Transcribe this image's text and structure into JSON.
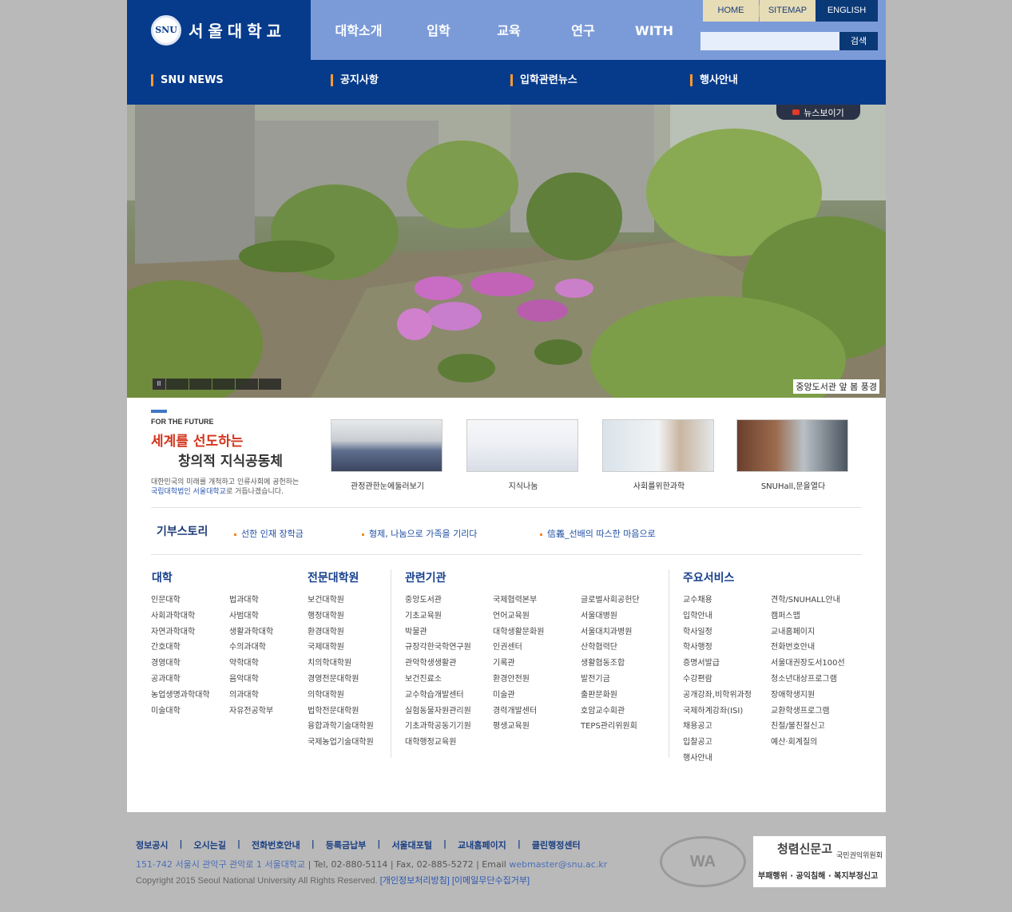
{
  "header": {
    "logo_text": "서울대학교",
    "seal_text": "SNU",
    "gnb": [
      "대학소개",
      "입학",
      "교육",
      "연구",
      "WITH SNU"
    ],
    "util": [
      "HOME",
      "SITEMAP",
      "ENGLISH"
    ],
    "search_button": "검색"
  },
  "subnav": [
    "SNU NEWS",
    "공지사항",
    "입학관련뉴스",
    "행사안내"
  ],
  "hero": {
    "badge": "뉴스보이기",
    "caption": "중앙도서관 앞 봄 풍경",
    "pause": "II"
  },
  "promo": {
    "kicker": "FOR THE FUTURE",
    "headline1": "세계를 선도하는",
    "headline2": "창의적 지식공동체",
    "desc1": "대한민국의 미래를 개척하고 인류사회에 공헌하는",
    "desc2_bold": "국립대학법인 서울대학교",
    "desc2": "로 거듭나겠습니다."
  },
  "thumbs": [
    "관정관한눈에둘러보기",
    "지식나눔",
    "사회를위한과학",
    "SNUHall,문을열다"
  ],
  "donation": {
    "title": "기부스토리",
    "items": [
      "선한 인재 장학금",
      "형제, 나눔으로 가족을 기리다",
      "信義_선배의 따스한 마음으로"
    ]
  },
  "sections": {
    "college": {
      "title": "대학",
      "col1": [
        "인문대학",
        "사회과학대학",
        "자연과학대학",
        "간호대학",
        "경영대학",
        "공과대학",
        "농업생명과학대학",
        "미술대학"
      ],
      "col2": [
        "법과대학",
        "사범대학",
        "생활과학대학",
        "수의과대학",
        "약학대학",
        "음악대학",
        "의과대학",
        "자유전공학부"
      ]
    },
    "grad": {
      "title": "전문대학원",
      "col1": [
        "보건대학원",
        "행정대학원",
        "환경대학원",
        "국제대학원",
        "치의학대학원",
        "경영전문대학원",
        "의학대학원",
        "법학전문대학원",
        "융합과학기술대학원",
        "국제농업기술대학원"
      ]
    },
    "related": {
      "title": "관련기관",
      "col1": [
        "중앙도서관",
        "기초교육원",
        "박물관",
        "규장각한국학연구원",
        "관악학생생활관",
        "보건진료소",
        "교수학습개발센터",
        "실험동물자원관리원",
        "기초과학공동기기원",
        "대학행정교육원"
      ],
      "col2": [
        "국제협력본부",
        "언어교육원",
        "대학생활문화원",
        "인권센터",
        "기록관",
        "환경안전원",
        "미술관",
        "경력개발센터",
        "평생교육원"
      ],
      "col3": [
        "글로벌사회공헌단",
        "서울대병원",
        "서울대치과병원",
        "산학협력단",
        "생활협동조합",
        "발전기금",
        "출판문화원",
        "호암교수회관",
        "TEPS관리위원회"
      ]
    },
    "services": {
      "title": "주요서비스",
      "col1": [
        "교수채용",
        "입학안내",
        "학사일정",
        "학사행정",
        "증명서발급",
        "수강편람",
        "공개강좌,비학위과정",
        "국제하계강좌(ISI)",
        "채용공고",
        "입찰공고",
        "행사안내"
      ],
      "col2": [
        "견학/SNUHALL안내",
        "캠퍼스맵",
        "교내홈페이지",
        "전화번호안내",
        "서울대권장도서100선",
        "청소년대상프로그램",
        "장애학생지원",
        "교환학생프로그램",
        "친절/불친절신고",
        "예산·회계질의"
      ]
    }
  },
  "footer": {
    "links": [
      "정보공시",
      "오시는길",
      "전화번호안내",
      "등록금납부",
      "서울대포털",
      "교내홈페이지",
      "클린행정센터"
    ],
    "address": "151-742 서울시 관악구 관악로 1 서울대학교",
    "contact": " | Tel, 02-880-5114 | Fax, 02-885-5272 | Email ",
    "email": "webmaster@snu.ac.kr",
    "copyright": "Copyright 2015 Seoul National University All Rights Reserved.",
    "privacy": "[개인정보처리방침]",
    "noemail": "[이메일무단수집거부]",
    "wa_badge": "WA",
    "clean_title": "청렴신문고",
    "clean_org": "국민권익위원회",
    "clean_sub": "부패행위 · 공익침해 · 복지부정신고"
  }
}
